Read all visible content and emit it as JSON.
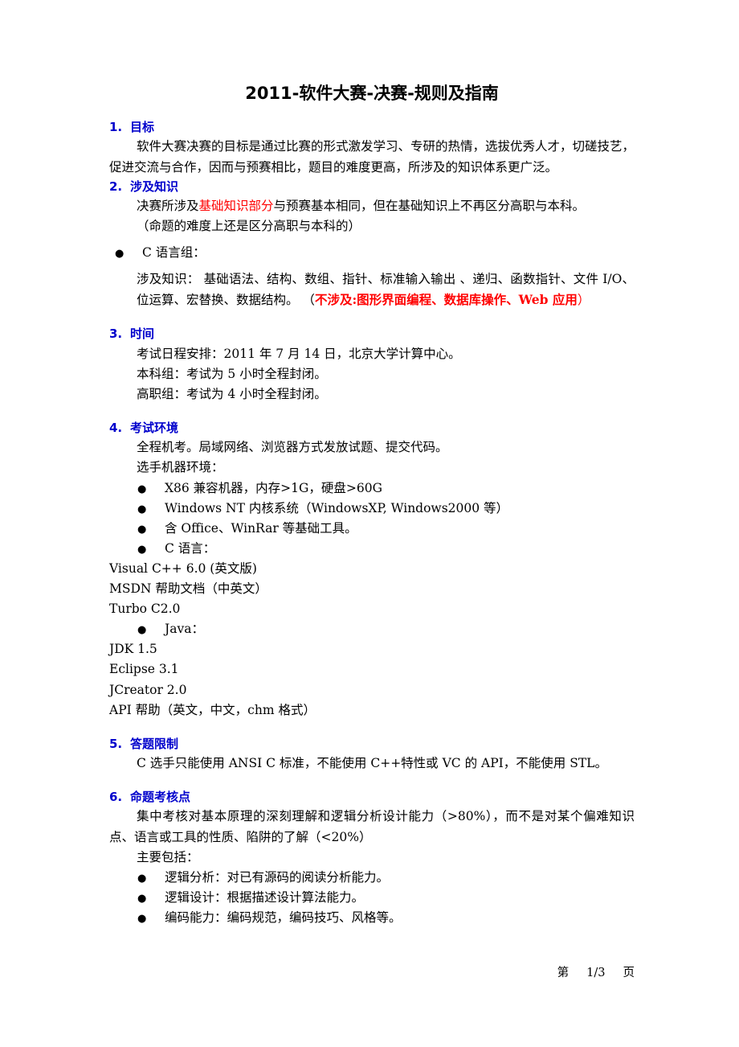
{
  "document": {
    "title": "2011-软件大赛-决赛-规则及指南"
  },
  "sections": [
    {
      "number": "1.",
      "title": "目标",
      "body": "软件大赛决赛的目标是通过比赛的形式激发学习、专研的热情，选拔优秀人才，切磋技艺，促进交流与合作，因而与预赛相比，题目的难度更高，所涉及的知识体系更广泛。"
    },
    {
      "number": "2.",
      "title": "涉及知识",
      "line1_pre": "决赛所涉及",
      "line1_red": "基础知识部分",
      "line1_post": "与预赛基本相同，但在基础知识上不再区分高职与本科。",
      "line2": "（命题的难度上还是区分高职与本科的）",
      "bullet_c": "C 语言组：",
      "knowledge_pre": "涉及知识：  基础语法、结构、数组、指针、标准输入输出 、递归、函数指针、文件 I/O、位运算、宏替换、数据结构。 （",
      "knowledge_red": "不涉及:图形界面编程、数据库操作、Web 应用",
      "knowledge_post": "）"
    },
    {
      "number": "3.",
      "title": "时间",
      "line1": "考试日程安排：2011 年 7 月 14 日，北京大学计算中心。",
      "line2": "本科组：考试为 5 小时全程封闭。",
      "line3": "高职组：考试为 4 小时全程封闭。"
    },
    {
      "number": "4.",
      "title": "考试环境",
      "line1": "全程机考。局域网络、浏览器方式发放试题、提交代码。",
      "line2": "选手机器环境：",
      "bullets": [
        "X86  兼容机器，内存>1G，硬盘>60G",
        "Windows NT  内核系统（WindowsXP, Windows2000 等）",
        "含 Office、WinRar 等基础工具。",
        "C  语言："
      ],
      "c_tools": [
        "Visual C++ 6.0 (英文版)",
        "MSDN 帮助文档（中英文）",
        "Turbo C2.0"
      ],
      "java_bullet": "Java：",
      "java_tools": [
        "JDK 1.5",
        "Eclipse 3.1",
        "JCreator 2.0",
        "API 帮助（英文，中文，chm 格式）"
      ]
    },
    {
      "number": "5.",
      "title": "答题限制",
      "body": "C 选手只能使用 ANSI C  标准，不能使用 C++特性或 VC 的 API，不能使用 STL。"
    },
    {
      "number": "6.",
      "title": "命题考核点",
      "body": "集中考核对基本原理的深刻理解和逻辑分析设计能力（>80%），而不是对某个偏难知识点、语言或工具的性质、陷阱的了解（<20%）",
      "intro": "主要包括：",
      "bullets": [
        "逻辑分析：对已有源码的阅读分析能力。",
        "逻辑设计：根据描述设计算法能力。",
        "编码能力：编码规范，编码技巧、风格等。"
      ]
    }
  ],
  "footer": {
    "prefix": "第",
    "page": "1/3",
    "suffix": "页"
  },
  "colors": {
    "heading": "#0000CC",
    "accent_red": "#FF0000",
    "text": "#000000",
    "background": "#FFFFFF"
  },
  "icons": {
    "bullet": "bullet-dot"
  }
}
